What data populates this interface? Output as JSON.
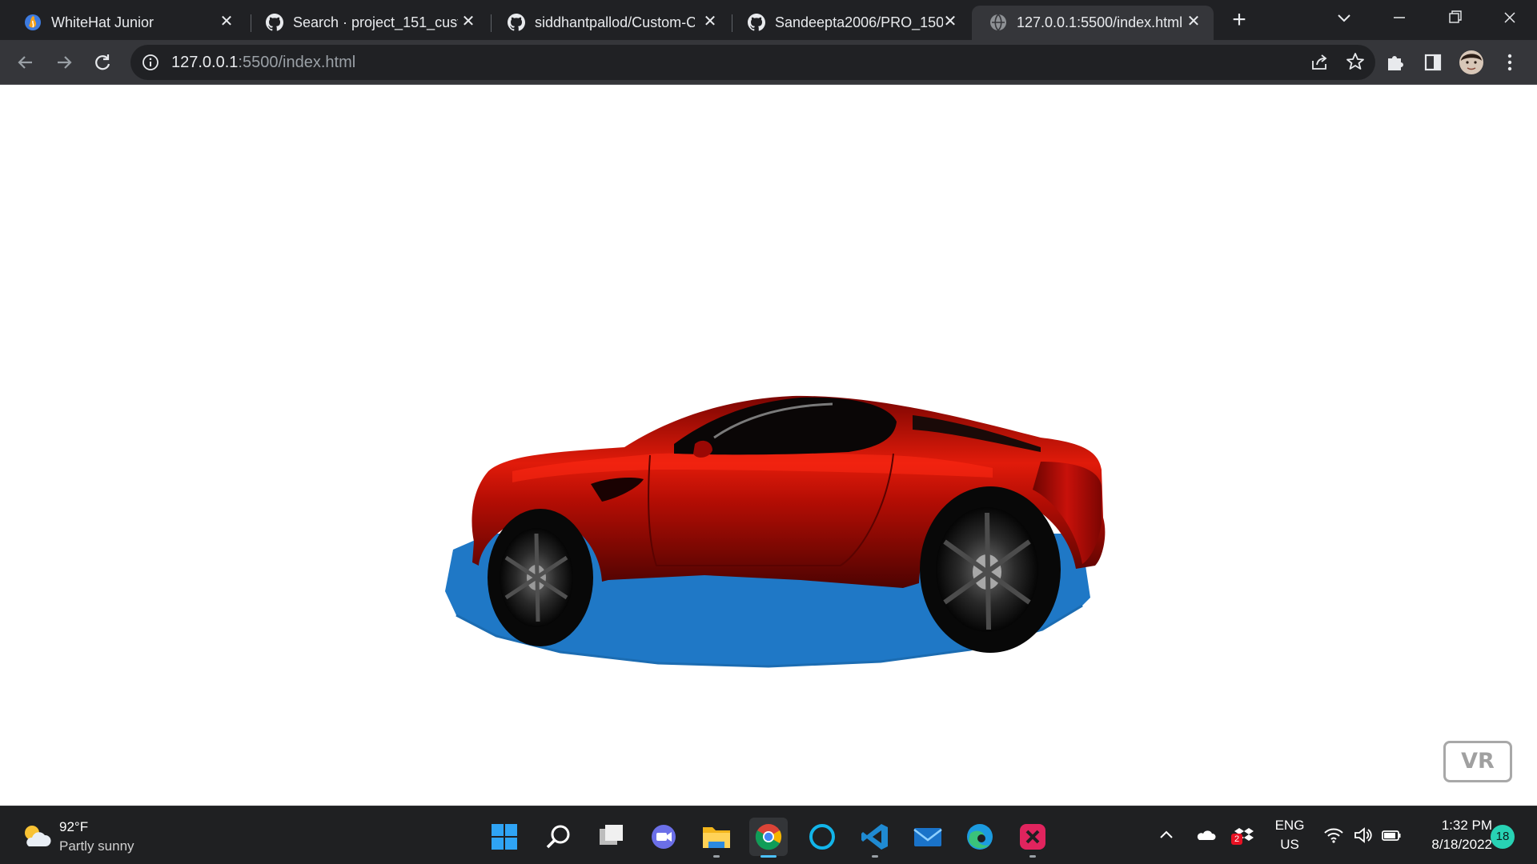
{
  "browser": {
    "tabs": [
      {
        "title": "WhiteHat Junior",
        "icon": "whitehat-icon",
        "active": false
      },
      {
        "title": "Search · project_151_custo",
        "icon": "github-icon",
        "active": false
      },
      {
        "title": "siddhantpallod/Custom-C",
        "icon": "github-icon",
        "active": false
      },
      {
        "title": "Sandeepta2006/PRO_150",
        "icon": "github-icon",
        "active": false
      },
      {
        "title": "127.0.0.1:5500/index.html",
        "icon": "globe-icon",
        "active": true
      }
    ],
    "new_tab_label": "+",
    "close_label": "✕",
    "address": {
      "host": "127.0.0.1",
      "rest": ":5500/index.html"
    }
  },
  "page": {
    "vr_label": "VR",
    "colors": {
      "car_body": "#c40a02",
      "platform": "#1f78c6"
    }
  },
  "taskbar": {
    "weather": {
      "temp": "92°F",
      "condition": "Partly sunny"
    },
    "apps": [
      "start-icon",
      "search-icon",
      "task-view-icon",
      "chat-icon",
      "file-explorer-icon",
      "chrome-icon",
      "cortana-icon",
      "vscode-icon",
      "mail-icon",
      "edge-icon",
      "app-icon"
    ],
    "language": {
      "line1": "ENG",
      "line2": "US"
    },
    "clock": {
      "time": "1:32 PM",
      "date": "8/18/2022"
    },
    "notifications": "18",
    "tray_badge": "2"
  }
}
